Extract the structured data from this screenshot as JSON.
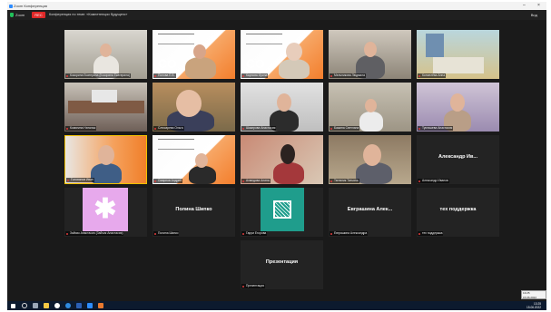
{
  "window": {
    "title": "Zoom Конференция"
  },
  "toolbar": {
    "view_label": "Zoom",
    "rec_label": "REC",
    "meeting_title": "Конференция по теме: «Компетенции будущего»",
    "view_button": "Вид"
  },
  "tiles": [
    {
      "name": "Кокорина Екатерина (Кокорина Екатерина)"
    },
    {
      "name": "Попова Е.В."
    },
    {
      "name": "Карпова Ирина"
    },
    {
      "name": "Мельникова Людмила"
    },
    {
      "name": "Коноплёва Анна"
    },
    {
      "name": "Комягина Наталья"
    },
    {
      "name": "Слюсарева Ольга"
    },
    {
      "name": "Шакирова Анастасия"
    },
    {
      "name": "Бажина Светлана"
    },
    {
      "name": "Тукташева Анастасия"
    },
    {
      "name": "Голованов Иван"
    },
    {
      "name": "Смирнов Андрей"
    },
    {
      "name": "Ахмедова Алина"
    },
    {
      "name": "Тютюник Татьяна"
    },
    {
      "name": "Александр Иванов"
    },
    {
      "name": "Зайчик Анастасия (Зайчик Анастасия)"
    },
    {
      "name": "Полина Шипко"
    },
    {
      "name": "Гарри Егорова"
    },
    {
      "name": "Евграшина Александра"
    },
    {
      "name": "тех поддержка"
    },
    {
      "name": "Презентация"
    }
  ],
  "center_labels": {
    "alexander": "Александр Ив...",
    "polina": "Полина Шипко",
    "evgrashina": "Евграшина Алек...",
    "support": "тех поддержка",
    "presentation": "Презентация"
  },
  "taskbar": {
    "time": "13:25",
    "date": "15.06.2022"
  },
  "colors": {
    "brand_orange": "#f37e2c",
    "tile_bg": "#232323",
    "taskbar_bg": "#0c1a2e",
    "rec_red": "#e02828"
  },
  "icons": [
    "windows-start-icon",
    "search-icon",
    "task-view-icon",
    "explorer-icon",
    "chrome-icon",
    "edge-icon",
    "word-icon",
    "zoom-icon"
  ]
}
